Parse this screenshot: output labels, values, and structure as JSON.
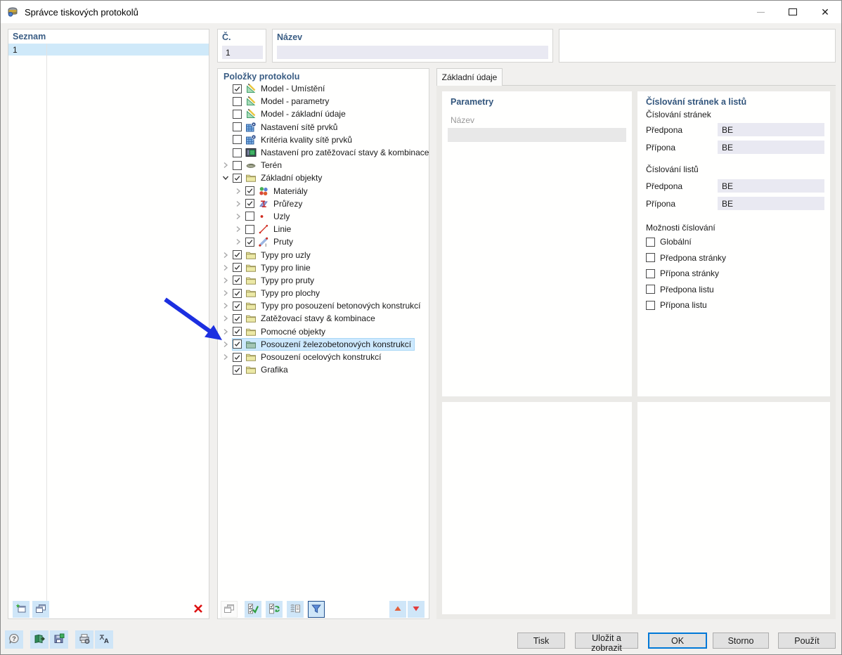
{
  "window": {
    "title": "Správce tiskových protokolů"
  },
  "colors": {
    "accent": "#0078d7",
    "selection_list": "#cfe9f9",
    "selection_tree": "#cde9ff",
    "arrow": "#1c2fe0",
    "input_bg": "#e9e9f2",
    "disabled_input_bg": "#e8e8e8",
    "header_text": "#3a5d84"
  },
  "list_panel": {
    "header": "Seznam",
    "rows": [
      {
        "number": "1",
        "name": ""
      }
    ],
    "toolbar": [
      {
        "name": "new-protocol",
        "style": "blue"
      },
      {
        "name": "copy-protocol",
        "style": "blue"
      },
      {
        "name": "delete-protocol",
        "style": "plain"
      }
    ]
  },
  "fields": {
    "number": {
      "label": "Č.",
      "value": "1"
    },
    "name": {
      "label": "Název",
      "value": ""
    }
  },
  "tree_panel": {
    "header": "Položky protokolu",
    "items": [
      {
        "label": "Model - Umístění",
        "checked": true,
        "expander": "none",
        "level": 0,
        "icon": "model"
      },
      {
        "label": "Model - parametry",
        "checked": false,
        "expander": "none",
        "level": 0,
        "icon": "model"
      },
      {
        "label": "Model - základní údaje",
        "checked": false,
        "expander": "none",
        "level": 0,
        "icon": "model"
      },
      {
        "label": "Nastavení sítě prvků",
        "checked": false,
        "expander": "none",
        "level": 0,
        "icon": "mesh"
      },
      {
        "label": "Kritéria kvality sítě prvků",
        "checked": false,
        "expander": "none",
        "level": 0,
        "icon": "mesh"
      },
      {
        "label": "Nastavení pro zatěžovací stavy & kombinace",
        "checked": false,
        "expander": "none",
        "level": 0,
        "icon": "load-settings"
      },
      {
        "label": "Terén",
        "checked": false,
        "expander": "collapsed",
        "level": 0,
        "icon": "terrain"
      },
      {
        "label": "Základní objekty",
        "checked": true,
        "expander": "expanded",
        "level": 0,
        "icon": "folder"
      },
      {
        "label": "Materiály",
        "checked": true,
        "expander": "collapsed",
        "level": 1,
        "icon": "materials"
      },
      {
        "label": "Průřezy",
        "checked": true,
        "expander": "collapsed",
        "level": 1,
        "icon": "sections"
      },
      {
        "label": "Uzly",
        "checked": false,
        "expander": "collapsed",
        "level": 1,
        "icon": "nodes"
      },
      {
        "label": "Linie",
        "checked": false,
        "expander": "collapsed",
        "level": 1,
        "icon": "lines"
      },
      {
        "label": "Pruty",
        "checked": true,
        "expander": "collapsed",
        "level": 1,
        "icon": "members"
      },
      {
        "label": "Typy pro uzly",
        "checked": true,
        "expander": "collapsed",
        "level": 0,
        "icon": "folder"
      },
      {
        "label": "Typy pro linie",
        "checked": true,
        "expander": "collapsed",
        "level": 0,
        "icon": "folder"
      },
      {
        "label": "Typy pro pruty",
        "checked": true,
        "expander": "collapsed",
        "level": 0,
        "icon": "folder"
      },
      {
        "label": "Typy pro plochy",
        "checked": true,
        "expander": "collapsed",
        "level": 0,
        "icon": "folder"
      },
      {
        "label": "Typy pro posouzení betonových konstrukcí",
        "checked": true,
        "expander": "collapsed",
        "level": 0,
        "icon": "folder"
      },
      {
        "label": "Zatěžovací stavy & kombinace",
        "checked": true,
        "expander": "collapsed",
        "level": 0,
        "icon": "folder"
      },
      {
        "label": "Pomocné objekty",
        "checked": true,
        "expander": "collapsed",
        "level": 0,
        "icon": "folder"
      },
      {
        "label": "Posouzení železobetonových konstrukcí",
        "checked": true,
        "expander": "collapsed",
        "level": 0,
        "icon": "folder-teal",
        "selected": true
      },
      {
        "label": "Posouzení ocelových konstrukcí",
        "checked": true,
        "expander": "collapsed",
        "level": 0,
        "icon": "folder"
      },
      {
        "label": "Grafika",
        "checked": true,
        "expander": "none",
        "level": 0,
        "icon": "folder"
      }
    ],
    "toolbar": [
      {
        "name": "copy-item",
        "style": "disabled"
      },
      {
        "name": "select-all",
        "style": "blue"
      },
      {
        "name": "invert-selection",
        "style": "blue"
      },
      {
        "name": "expand-items",
        "style": "blue"
      },
      {
        "name": "filter",
        "style": "blue-active"
      }
    ],
    "move_buttons": [
      {
        "name": "move-up",
        "style": "blue"
      },
      {
        "name": "move-down",
        "style": "blue"
      }
    ]
  },
  "details": {
    "tab": "Základní údaje",
    "parameters": {
      "header": "Parametry",
      "name_label": "Název",
      "name_value": ""
    },
    "numbering": {
      "header": "Číslování stránek a listů",
      "pages_header": "Číslování stránek",
      "page_rows": [
        {
          "label": "Předpona",
          "value": "BE"
        },
        {
          "label": "Přípona",
          "value": "BE"
        }
      ],
      "sheets_header": "Číslování listů",
      "sheet_rows": [
        {
          "label": "Předpona",
          "value": "BE"
        },
        {
          "label": "Přípona",
          "value": "BE"
        }
      ],
      "options_header": "Možnosti číslování",
      "options": [
        {
          "label": "Globální",
          "checked": false
        },
        {
          "label": "Předpona stránky",
          "checked": false
        },
        {
          "label": "Přípona stránky",
          "checked": false
        },
        {
          "label": "Předpona listu",
          "checked": false
        },
        {
          "label": "Přípona listu",
          "checked": false
        }
      ]
    }
  },
  "footer": {
    "tools": [
      {
        "name": "help"
      },
      {
        "name": "open-protocol"
      },
      {
        "name": "save-template"
      },
      {
        "name": "print-settings"
      },
      {
        "name": "language"
      }
    ],
    "buttons": [
      {
        "label": "Tisk",
        "default": false
      },
      {
        "label": "Uložit a zobrazit",
        "default": false
      },
      {
        "label": "OK",
        "default": true
      },
      {
        "label": "Storno",
        "default": false
      },
      {
        "label": "Použít",
        "default": false
      }
    ]
  },
  "annotation": {
    "type": "arrow",
    "color": "#1c2fe0",
    "target": "Posouzení železobetonových konstrukcí"
  }
}
